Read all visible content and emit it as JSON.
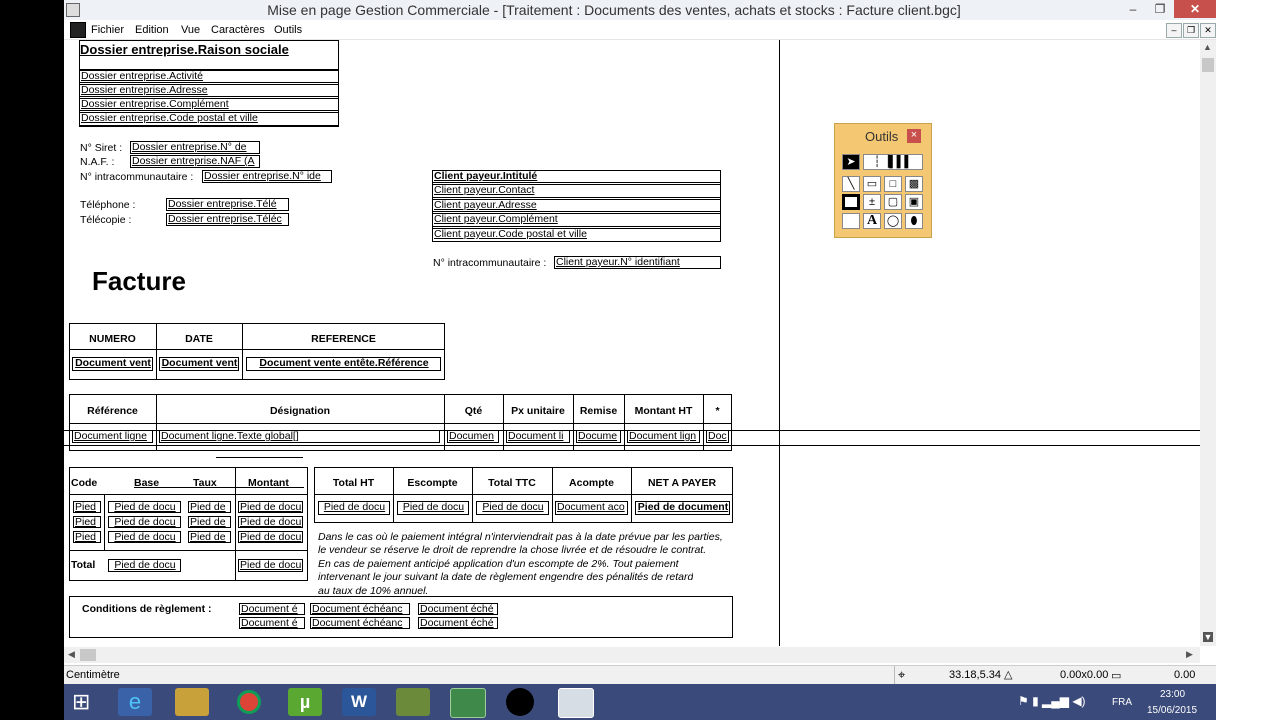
{
  "window": {
    "title": "Mise en page Gestion Commerciale - [Traitement : Documents des ventes, achats et stocks : Facture client.bgc]",
    "min": "–",
    "max": "❐",
    "close": "✕"
  },
  "menu": [
    "Fichier",
    "Edition",
    "Vue",
    "Caractères",
    "Outils"
  ],
  "mdi": {
    "min": "–",
    "restore": "❐",
    "close": "✕"
  },
  "company": {
    "name": "Dossier entreprise.Raison sociale",
    "activity": "Dossier entreprise.Activité",
    "address": "Dossier entreprise.Adresse",
    "complement": "Dossier entreprise.Complément",
    "city": "Dossier entreprise.Code postal et ville",
    "siret_label": "N° Siret :",
    "siret_value": "Dossier entreprise.N° de",
    "naf_label": "N.A.F. :",
    "naf_value": "Dossier entreprise.NAF (A",
    "intra_label": "N° intracommunautaire :",
    "intra_value": "Dossier entreprise.N° ide",
    "phone_label": "Téléphone :",
    "phone_value": "Dossier entreprise.Télé",
    "fax_label": "Télécopie :",
    "fax_value": "Dossier entreprise.Téléc"
  },
  "client": {
    "name": "Client payeur.Intitulé",
    "contact": "Client payeur.Contact",
    "address": "Client payeur.Adresse",
    "complement": "Client payeur.Complément",
    "city": "Client payeur.Code postal et ville",
    "intra_label": "N° intracommunautaire :",
    "intra_value": "Client payeur.N° identifiant"
  },
  "doc_title": "Facture",
  "header_table": {
    "cols": [
      "NUMERO",
      "DATE",
      "REFERENCE"
    ],
    "vals": [
      "Document vent",
      "Document vent",
      "Document vente entête.Référence"
    ]
  },
  "lines_table": {
    "cols": [
      "Référence",
      "Désignation",
      "Qté",
      "Px unitaire",
      "Remise",
      "Montant HT",
      "*"
    ],
    "vals": [
      "Document ligne",
      "Document ligne.Texte global[]",
      "Documen",
      "Document li",
      "Docume",
      "Document lign",
      "Doc"
    ]
  },
  "tax_table": {
    "cols": [
      "Code",
      "Base",
      "Taux",
      "Montant"
    ],
    "row_field": [
      "Pied",
      "Pied de docu",
      "Pied de",
      "Pied de docu"
    ],
    "total_label": "Total",
    "total_base": "Pied de docu",
    "total_amount": "Pied de docu"
  },
  "totals_table": {
    "cols": [
      "Total HT",
      "Escompte",
      "Total TTC",
      "Acompte",
      "NET A PAYER"
    ],
    "vals": [
      "Pied de docu",
      "Pied de docu",
      "Pied de docu",
      "Document aco",
      "Pied de document"
    ]
  },
  "legal_text": [
    "Dans le cas où le paiement intégral n'interviendrait pas à la date prévue par les parties,",
    "le vendeur se réserve le droit de reprendre la chose livrée et de résoudre le contrat.",
    "En cas de  paiement anticipé application d'un escompte  de  2%.  Tout paiement",
    "intervenant le jour suivant la date de règlement engendre des pénalités de retard",
    "au taux de 10% annuel."
  ],
  "conditions": {
    "label": "Conditions de règlement :",
    "fields": [
      "Document é",
      "Document échéanc",
      "Document éché"
    ]
  },
  "palette": {
    "title": "Outils",
    "close": "×"
  },
  "status": {
    "unit": "Centimètre",
    "position": "33.18,5.34",
    "size": "0.00x0.00",
    "thickness": "0.00"
  },
  "taskbar": {
    "lang": "FRA",
    "time": "23:00",
    "date": "15/06/2015"
  },
  "colors": {
    "taskbar": "#3a4a7a",
    "palette": "#f4c872",
    "close": "#c7504c"
  }
}
